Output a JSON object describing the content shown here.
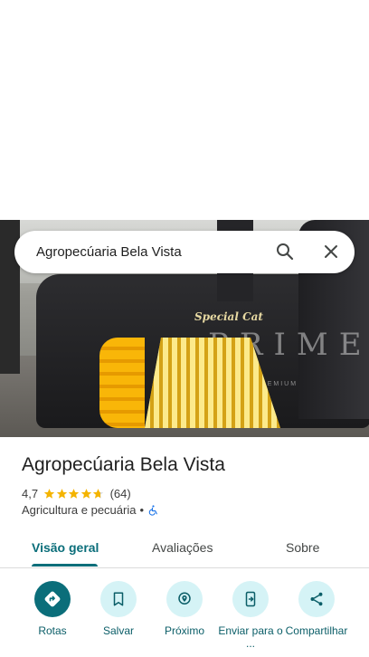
{
  "search": {
    "query": "Agropecúaria Bela Vista"
  },
  "hero": {
    "banner_brand": "Special Cat",
    "banner_product": "PRIME",
    "banner_tagline": "PREMIUM"
  },
  "place": {
    "title": "Agropecúaria Bela Vista",
    "rating": "4,7",
    "rating_stars": 4.7,
    "review_count": "(64)",
    "category": "Agricultura e pecuária",
    "separator": "•"
  },
  "tabs": [
    {
      "label": "Visão geral",
      "active": true
    },
    {
      "label": "Avaliações",
      "active": false
    },
    {
      "label": "Sobre",
      "active": false
    }
  ],
  "actions": [
    {
      "label": "Rotas",
      "icon": "directions-icon"
    },
    {
      "label": "Salvar",
      "icon": "bookmark-icon"
    },
    {
      "label": "Próximo",
      "icon": "nearby-icon"
    },
    {
      "label": "Enviar para o ...",
      "icon": "send-to-phone-icon"
    },
    {
      "label": "Compartilhar",
      "icon": "share-icon"
    }
  ],
  "colors": {
    "accent": "#0b6e7a",
    "action_bg": "#d5f3f6",
    "star": "#f4b400"
  }
}
